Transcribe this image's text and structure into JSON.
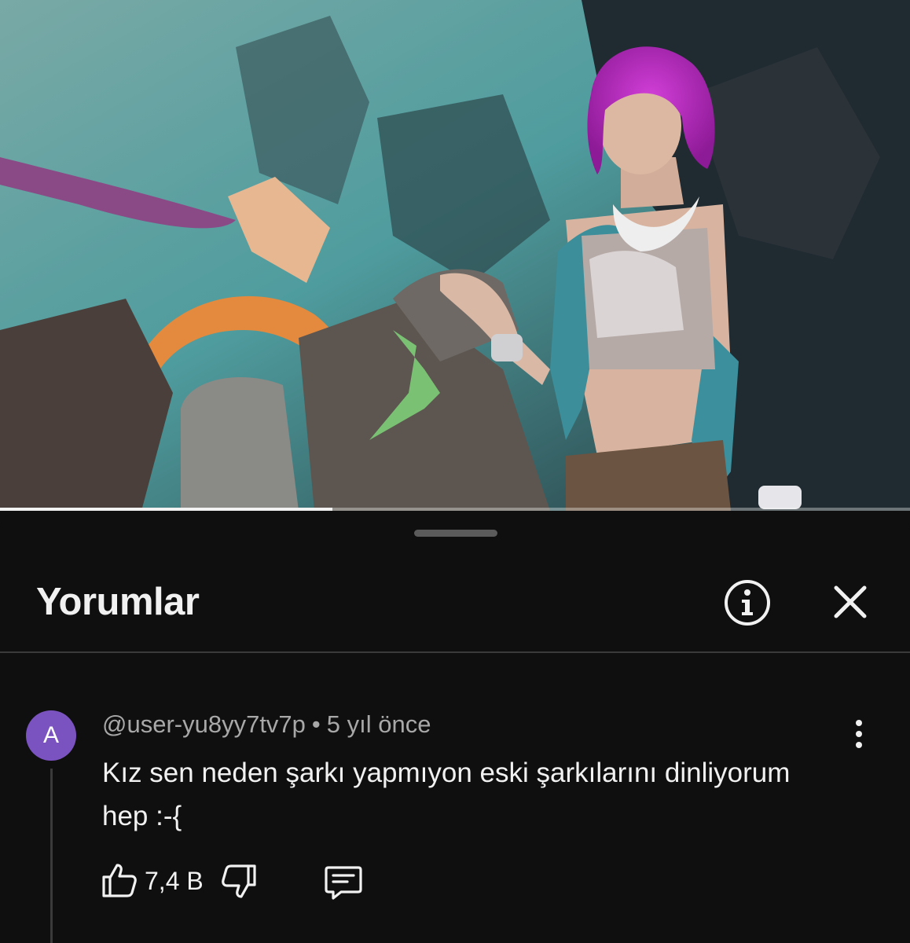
{
  "video": {
    "progress_fraction": 0.365
  },
  "comments_panel": {
    "title": "Yorumlar",
    "icons": {
      "info": "info-icon",
      "close": "close-icon"
    }
  },
  "comment": {
    "avatar_letter": "A",
    "avatar_color": "#7b53c1",
    "username": "@user-yu8yy7tv7p",
    "separator": "•",
    "time": "5 yıl önce",
    "text": "Kız sen neden şarkı yapmıyon eski şarkılarını dinliyorum hep :-{",
    "like_count": "7,4 B",
    "icons": {
      "like": "thumbs-up-icon",
      "dislike": "thumbs-down-icon",
      "reply": "reply-comment-icon",
      "more": "more-vertical-icon"
    }
  },
  "colors": {
    "background": "#0f0f0f",
    "text_primary": "#f1f1f1",
    "text_secondary": "#a8a8a8"
  }
}
